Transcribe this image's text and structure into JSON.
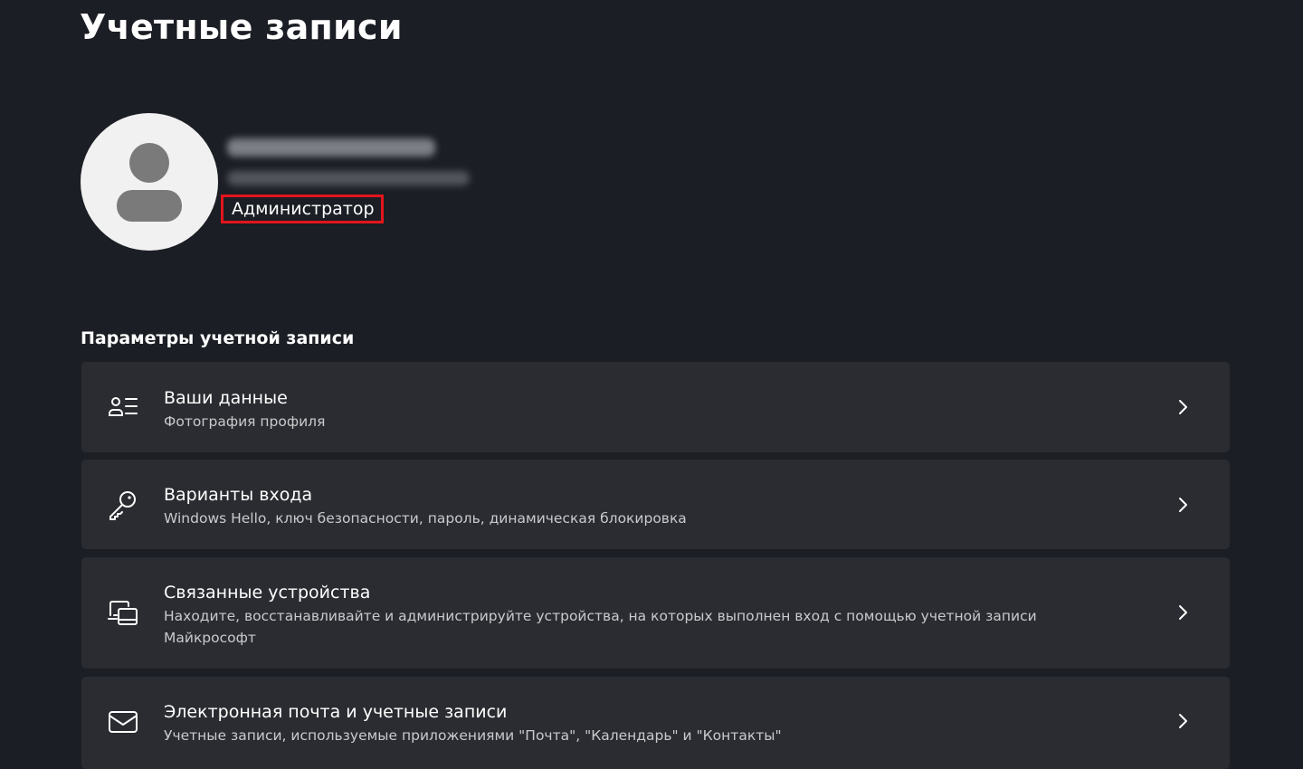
{
  "page": {
    "title": "Учетные записи"
  },
  "profile": {
    "role": "Администратор"
  },
  "account_settings": {
    "heading": "Параметры учетной записи",
    "items": [
      {
        "title": "Ваши данные",
        "subtitle": "Фотография профиля",
        "icon": "person-list-icon"
      },
      {
        "title": "Варианты входа",
        "subtitle": "Windows Hello, ключ безопасности, пароль, динамическая блокировка",
        "icon": "key-icon"
      },
      {
        "title": "Связанные устройства",
        "subtitle": "Находите, восстанавливайте и администрируйте устройства, на которых выполнен вход с помощью учетной записи Майкрософт",
        "icon": "devices-icon"
      },
      {
        "title": "Электронная почта и учетные записи",
        "subtitle": "Учетные записи, используемые приложениями \"Почта\", \"Календарь\" и \"Контакты\"",
        "icon": "mail-icon"
      }
    ]
  },
  "colors": {
    "background": "#1b1e24",
    "card": "#2a2c31",
    "highlight_border": "#e4141b",
    "subtitle_text": "#c9cacc"
  }
}
